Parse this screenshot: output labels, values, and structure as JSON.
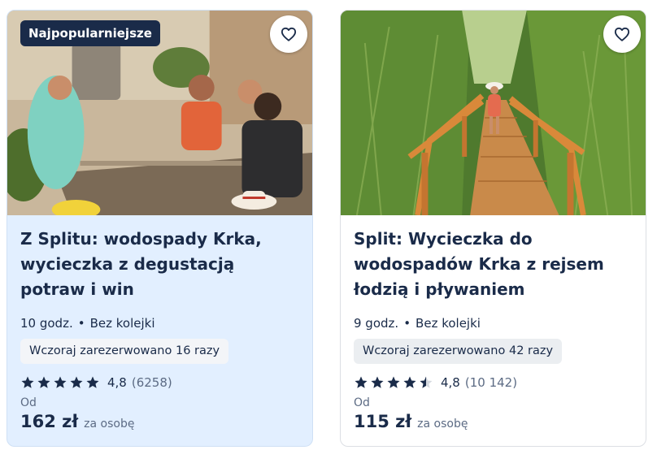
{
  "cards": [
    {
      "badge": "Najpopularniejsze",
      "title": "Z Splitu: wodospady Krka, wycieczka z degustacją potraw i win",
      "duration": "10 godz.",
      "separator": "•",
      "feature": "Bez kolejki",
      "booked": "Wczoraj zarezerwowano 16 razy",
      "rating_value": 5,
      "score": "4,8",
      "count": "(6258)",
      "from_label": "Od",
      "price": "162 zł",
      "per": "za osobę",
      "image": "wine-tasting-group-photo"
    },
    {
      "title": "Split: Wycieczka do wodospadów Krka z rejsem łodzią i pływaniem",
      "duration": "9 godz.",
      "separator": "•",
      "feature": "Bez kolejki",
      "booked": "Wczoraj zarezerwowano 42 razy",
      "rating_value": 4.5,
      "score": "4,8",
      "count": "(10 142)",
      "from_label": "Od",
      "price": "115 zł",
      "per": "za osobę",
      "image": "wooden-boardwalk-reeds-photo"
    }
  ],
  "colors": {
    "text": "#1a2b49",
    "highlight_card": "#e2efff",
    "badge": "#1a2b49"
  }
}
